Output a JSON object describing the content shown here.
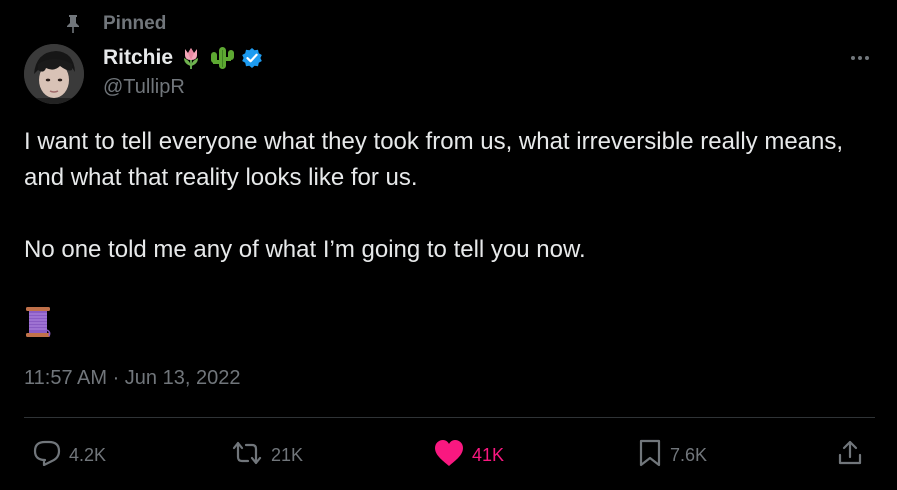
{
  "tweet": {
    "pinned_label": "Pinned",
    "author": {
      "display_name": "Ritchie",
      "name_emojis": [
        "tulip-emoji",
        "cactus-emoji"
      ],
      "verified": true,
      "handle": "@TullipR"
    },
    "text_paragraphs": [
      "I want to tell everyone what they took from us, what irreversible really means, and what that reality looks like for us.",
      "No one told me any of what I’m going to tell you now."
    ],
    "thread_emoji": "thread-spool-emoji",
    "timestamp": "11:57 AM · Jun 13, 2022",
    "actions": {
      "replies": "4.2K",
      "reposts": "21K",
      "likes": "41K",
      "bookmarks": "7.6K"
    }
  },
  "colors": {
    "background": "#000000",
    "text_primary": "#e7e9ea",
    "text_secondary": "#71767b",
    "like_active": "#f91880",
    "verified_badge": "#1d9bf0",
    "divider": "#2f3336"
  }
}
